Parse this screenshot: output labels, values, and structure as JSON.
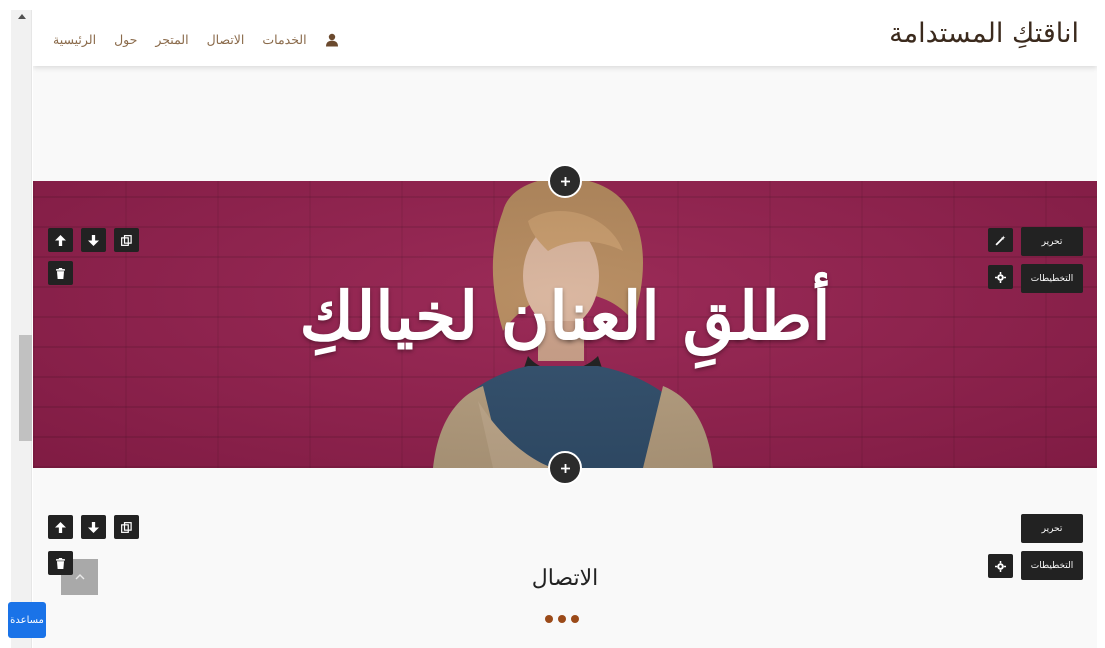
{
  "brand": {
    "title": "اناقتكِ المستدامة"
  },
  "nav": {
    "items": [
      {
        "label": "الرئيسية"
      },
      {
        "label": "حول"
      },
      {
        "label": "المتجر"
      },
      {
        "label": "الاتصال"
      },
      {
        "label": "الخدمات"
      }
    ],
    "user_icon": "user-icon"
  },
  "hero": {
    "title": "أطلقِ العنان لخيالكِ",
    "background_color": "#96204f"
  },
  "editor": {
    "edit_label": "تحرير",
    "layouts_label": "التخطيطات",
    "icons": [
      "arrow-up-icon",
      "arrow-down-icon",
      "copy-icon",
      "trash-icon",
      "magic-wand-icon",
      "gear-icon",
      "plus-icon"
    ]
  },
  "section": {
    "title": "الاتصال",
    "accent": "#9b4a19"
  },
  "help": {
    "label": "مساعدة"
  }
}
